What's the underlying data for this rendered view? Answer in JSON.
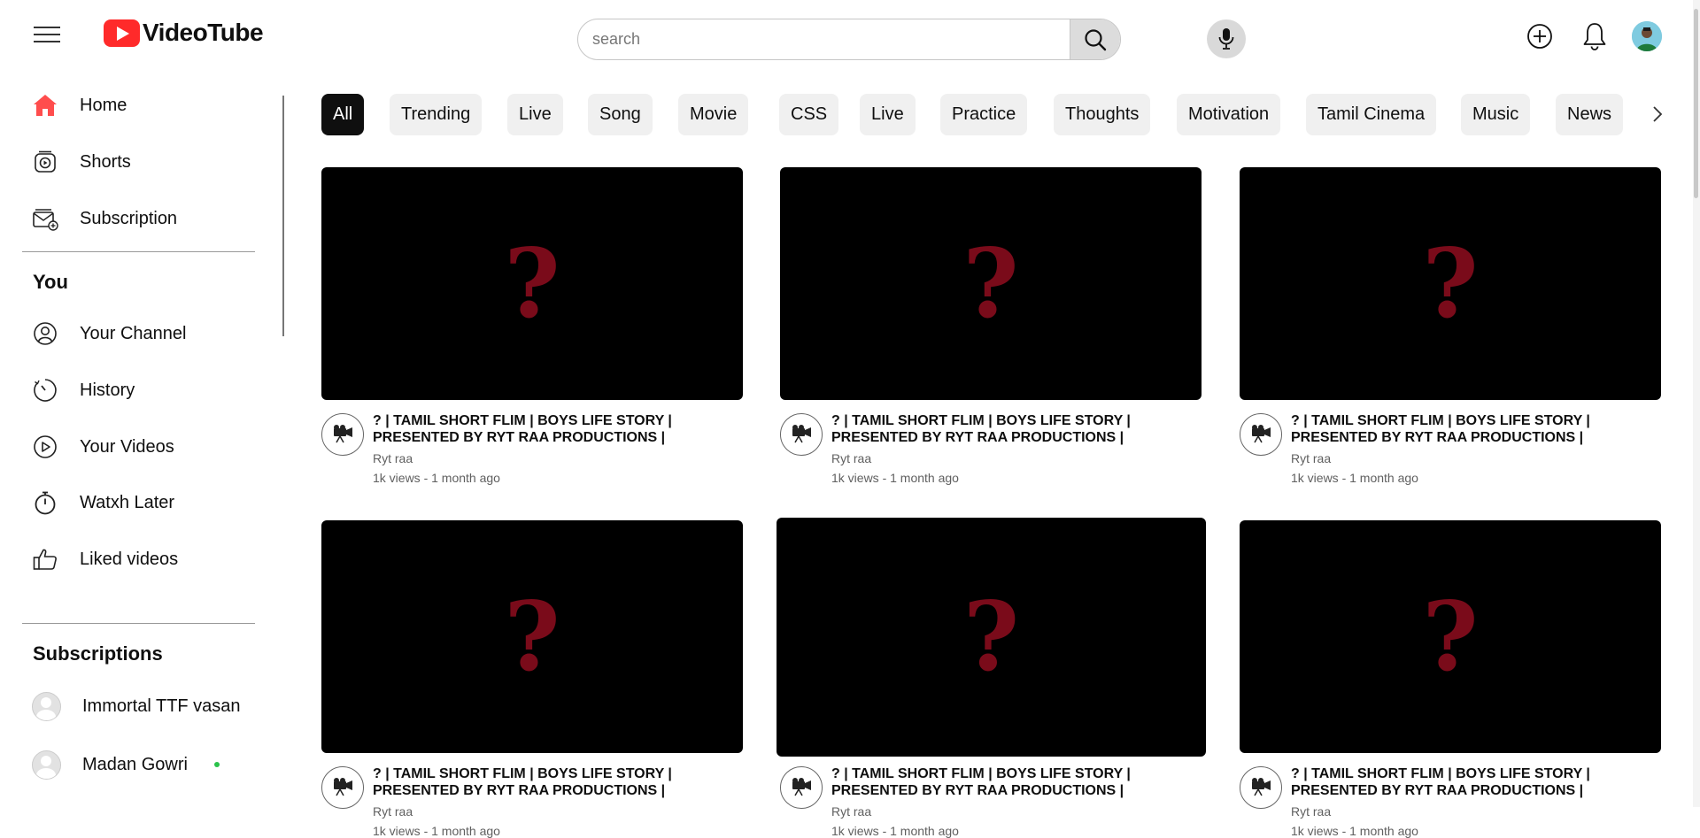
{
  "header": {
    "app_name": "VideoTube",
    "search_placeholder": "search",
    "search_value": "",
    "icons": {
      "menu": "hamburger-menu-icon",
      "search": "search-icon",
      "mic": "microphone-icon",
      "create": "plus-circle-icon",
      "notifications": "bell-icon",
      "avatar": "user-avatar"
    }
  },
  "sidebar": {
    "main_items": [
      {
        "label": "Home",
        "icon": "home-icon"
      },
      {
        "label": "Shorts",
        "icon": "shorts-icon"
      },
      {
        "label": "Subscription",
        "icon": "subscription-icon"
      }
    ],
    "you_title": "You",
    "you_items": [
      {
        "label": "Your Channel",
        "icon": "user-circle-icon"
      },
      {
        "label": "History",
        "icon": "history-icon"
      },
      {
        "label": "Your Videos",
        "icon": "play-circle-icon"
      },
      {
        "label": "Watxh Later",
        "icon": "stopwatch-icon"
      },
      {
        "label": "Liked videos",
        "icon": "thumbs-up-icon"
      }
    ],
    "subscriptions_title": "Subscriptions",
    "subscriptions": [
      {
        "label": "Immortal TTF vasan",
        "live": false
      },
      {
        "label": "Madan Gowri",
        "live": true
      }
    ]
  },
  "chips": [
    "All",
    "Trending",
    "Live",
    "Song",
    "Movie",
    "CSS",
    "Live",
    "Practice",
    "Thoughts",
    "Motivation",
    "Tamil Cinema",
    "Music",
    "News"
  ],
  "active_chip": "All",
  "videos": [
    {
      "title": "? | TAMIL SHORT FLIM | BOYS LIFE STORY | PRESENTED BY RYT RAA PRODUCTIONS |",
      "channel": "Ryt raa",
      "meta": "1k views - 1 month ago",
      "thumb_glyph": "?"
    },
    {
      "title": "? | TAMIL SHORT FLIM | BOYS LIFE STORY | PRESENTED BY RYT RAA PRODUCTIONS |",
      "channel": "Ryt raa",
      "meta": "1k views - 1 month ago",
      "thumb_glyph": "?"
    },
    {
      "title": "? | TAMIL SHORT FLIM | BOYS LIFE STORY | PRESENTED BY RYT RAA PRODUCTIONS |",
      "channel": "Ryt raa",
      "meta": "1k views - 1 month ago",
      "thumb_glyph": "?"
    },
    {
      "title": "? | TAMIL SHORT FLIM | BOYS LIFE STORY | PRESENTED BY RYT RAA PRODUCTIONS |",
      "channel": "Ryt raa",
      "meta": "1k views - 1 month ago",
      "thumb_glyph": "?"
    },
    {
      "title": "? | TAMIL SHORT FLIM | BOYS LIFE STORY | PRESENTED BY RYT RAA PRODUCTIONS |",
      "channel": "Ryt raa",
      "meta": "1k views - 1 month ago",
      "thumb_glyph": "?"
    },
    {
      "title": "? | TAMIL SHORT FLIM | BOYS LIFE STORY | PRESENTED BY RYT RAA PRODUCTIONS |",
      "channel": "Ryt raa",
      "meta": "1k views - 1 month ago",
      "thumb_glyph": "?"
    }
  ],
  "colors": {
    "brand": "#ff2a2a",
    "home_active": "#ff4d4d",
    "thumb_mark": "#7a0b1a",
    "live_dot": "#2bc24a"
  }
}
